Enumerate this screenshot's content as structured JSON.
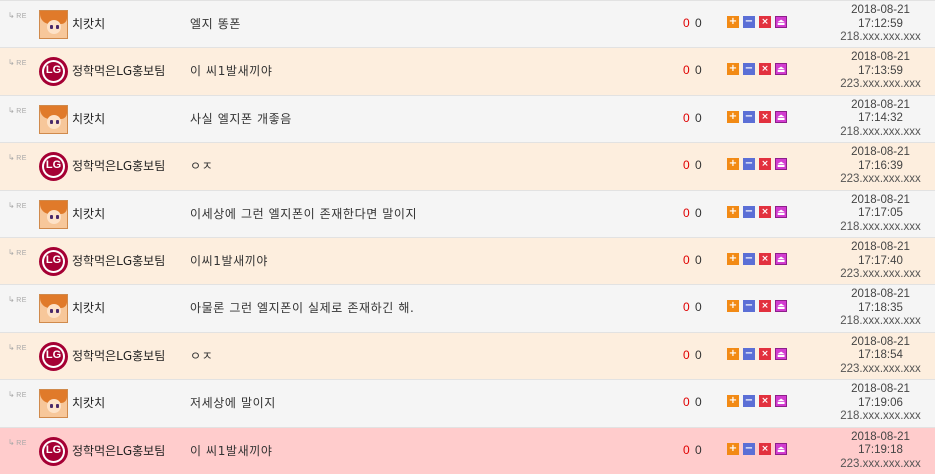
{
  "rows": [
    {
      "nick": "치캇치",
      "avatar": "anime-avatar",
      "content": "엘지 똥폰",
      "votes_up": "0",
      "votes_down": "0",
      "date": "2018-08-21",
      "time": "17:12:59",
      "ip": "218.xxx.xxx.xxx",
      "style": "light"
    },
    {
      "nick": "정학먹은LG홍보팀",
      "avatar": "lg-logo-avatar",
      "content": "이 씨1발새끼야",
      "votes_up": "0",
      "votes_down": "0",
      "date": "2018-08-21",
      "time": "17:13:59",
      "ip": "223.xxx.xxx.xxx",
      "style": "peach"
    },
    {
      "nick": "치캇치",
      "avatar": "anime-avatar",
      "content": "사실 엘지폰 개좋음",
      "votes_up": "0",
      "votes_down": "0",
      "date": "2018-08-21",
      "time": "17:14:32",
      "ip": "218.xxx.xxx.xxx",
      "style": "light"
    },
    {
      "nick": "정학먹은LG홍보팀",
      "avatar": "lg-logo-avatar",
      "content": "ㅇㅈ",
      "votes_up": "0",
      "votes_down": "0",
      "date": "2018-08-21",
      "time": "17:16:39",
      "ip": "223.xxx.xxx.xxx",
      "style": "peach"
    },
    {
      "nick": "치캇치",
      "avatar": "anime-avatar",
      "content": "이세상에 그런 엘지폰이 존재한다면 말이지",
      "votes_up": "0",
      "votes_down": "0",
      "date": "2018-08-21",
      "time": "17:17:05",
      "ip": "218.xxx.xxx.xxx",
      "style": "light"
    },
    {
      "nick": "정학먹은LG홍보팀",
      "avatar": "lg-logo-avatar",
      "content": "이씨1발새끼야",
      "votes_up": "0",
      "votes_down": "0",
      "date": "2018-08-21",
      "time": "17:17:40",
      "ip": "223.xxx.xxx.xxx",
      "style": "peach"
    },
    {
      "nick": "치캇치",
      "avatar": "anime-avatar",
      "content": "아물론 그런 엘지폰이 실제로 존재하긴 해.",
      "votes_up": "0",
      "votes_down": "0",
      "date": "2018-08-21",
      "time": "17:18:35",
      "ip": "218.xxx.xxx.xxx",
      "style": "light"
    },
    {
      "nick": "정학먹은LG홍보팀",
      "avatar": "lg-logo-avatar",
      "content": "ㅇㅈ",
      "votes_up": "0",
      "votes_down": "0",
      "date": "2018-08-21",
      "time": "17:18:54",
      "ip": "223.xxx.xxx.xxx",
      "style": "peach"
    },
    {
      "nick": "치캇치",
      "avatar": "anime-avatar",
      "content": "저세상에 말이지",
      "votes_up": "0",
      "votes_down": "0",
      "date": "2018-08-21",
      "time": "17:19:06",
      "ip": "218.xxx.xxx.xxx",
      "style": "light"
    },
    {
      "nick": "정학먹은LG홍보팀",
      "avatar": "lg-logo-avatar",
      "content": "이 씨1발새끼야",
      "votes_up": "0",
      "votes_down": "0",
      "date": "2018-08-21",
      "time": "17:19:18",
      "ip": "223.xxx.xxx.xxx",
      "style": "pink"
    }
  ],
  "labels": {
    "reply_marker": "RE",
    "btn_plus": "+",
    "btn_minus": "−",
    "btn_x": "×",
    "btn_alarm": "⏏",
    "lg_glyph": "LG"
  },
  "colors": {
    "row_light": "#f5f5f5",
    "row_peach": "#fdeede",
    "row_highlight": "#ffcccc",
    "vote_up": "#e00000",
    "btn_plus": "#f28a15",
    "btn_minus": "#5b6fd6",
    "btn_x": "#e2313e",
    "btn_alarm": "#d23cd0"
  }
}
